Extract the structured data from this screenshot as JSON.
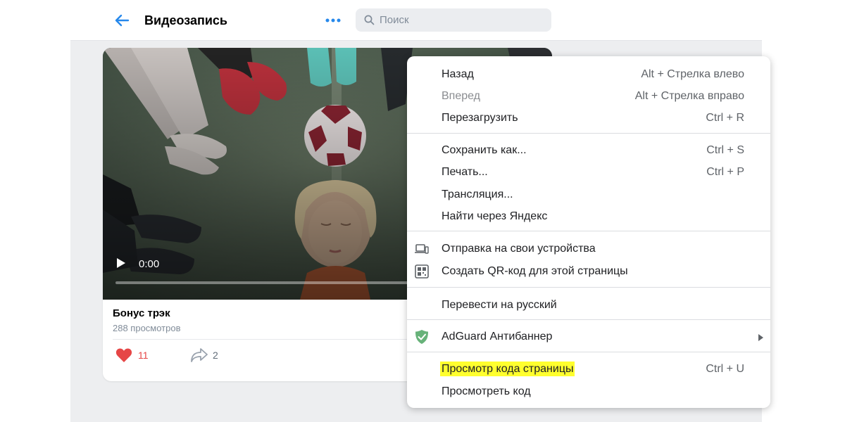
{
  "header": {
    "title": "Видеозапись",
    "search_placeholder": "Поиск"
  },
  "video": {
    "time": "0:00",
    "title": "Бонус трэк",
    "views": "288 просмотров",
    "likes": "11",
    "shares": "2"
  },
  "menu": {
    "items": [
      {
        "label": "Назад",
        "shortcut": "Alt + Стрелка влево"
      },
      {
        "label": "Вперед",
        "shortcut": "Alt + Стрелка вправо"
      },
      {
        "label": "Перезагрузить",
        "shortcut": "Ctrl + R"
      },
      {
        "label": "Сохранить как...",
        "shortcut": "Ctrl + S"
      },
      {
        "label": "Печать...",
        "shortcut": "Ctrl + P"
      },
      {
        "label": "Трансляция...",
        "shortcut": ""
      },
      {
        "label": "Найти через Яндекс",
        "shortcut": ""
      },
      {
        "label": "Отправка на свои устройства",
        "shortcut": ""
      },
      {
        "label": "Создать QR-код для этой страницы",
        "shortcut": ""
      },
      {
        "label": "Перевести на русский",
        "shortcut": ""
      },
      {
        "label": "AdGuard Антибаннер",
        "shortcut": ""
      },
      {
        "label": "Просмотр кода страницы",
        "shortcut": "Ctrl + U"
      },
      {
        "label": "Просмотреть код",
        "shortcut": ""
      }
    ]
  },
  "colors": {
    "accent": "#2688eb",
    "like": "#e64646",
    "highlight": "#ffff2e",
    "adguard": "#67b279"
  }
}
